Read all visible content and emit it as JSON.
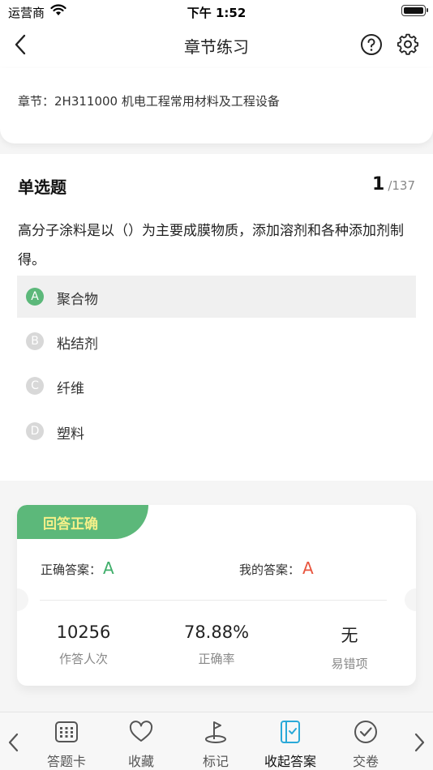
{
  "status_bar": {
    "carrier": "运营商",
    "time": "下午 1:52"
  },
  "nav": {
    "title": "章节练习"
  },
  "chapter": {
    "text": "章节：2H311000    机电工程常用材料及工程设备"
  },
  "question": {
    "type": "单选题",
    "current": "1",
    "total": "/137",
    "stem": "高分子涂料是以（）为主要成膜物质，添加溶剂和各种添加剂制得。",
    "options": [
      {
        "letter": "A",
        "text": "聚合物",
        "selected": true
      },
      {
        "letter": "B",
        "text": "粘结剂",
        "selected": false
      },
      {
        "letter": "C",
        "text": "纤维",
        "selected": false
      },
      {
        "letter": "D",
        "text": "塑料",
        "selected": false
      }
    ]
  },
  "result": {
    "banner": "回答正确",
    "correct_label": "正确答案：",
    "correct_value": "A",
    "my_label": "我的答案：",
    "my_value": "A",
    "stats": [
      {
        "value": "10256",
        "caption": "作答人次"
      },
      {
        "value": "78.88%",
        "caption": "正确率"
      },
      {
        "value": "无",
        "caption": "易错项"
      }
    ]
  },
  "tabbar": {
    "items": [
      {
        "label": "答题卡",
        "icon": "answer-card-icon"
      },
      {
        "label": "收藏",
        "icon": "heart-icon"
      },
      {
        "label": "标记",
        "icon": "flag-icon"
      },
      {
        "label": "收起答案",
        "icon": "collapse-answer-icon"
      },
      {
        "label": "交卷",
        "icon": "check-circle-icon"
      }
    ]
  },
  "colors": {
    "accent_green": "#5cb87a",
    "banner_text": "#f5f089",
    "correct_answer": "#3fae6a",
    "my_answer": "#e8553e",
    "active_tab": "#2aa9d8"
  }
}
